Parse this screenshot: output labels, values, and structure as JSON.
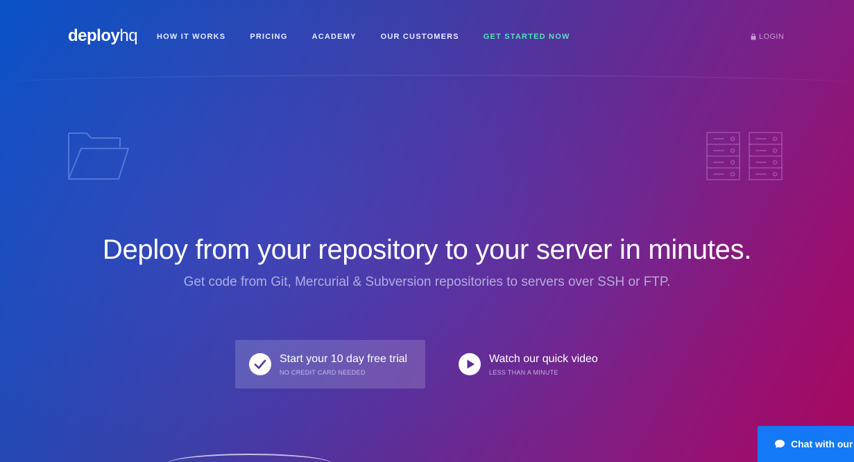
{
  "brand": {
    "logo_bold": "deploy",
    "logo_light": "hq"
  },
  "nav": {
    "items": [
      {
        "label": "HOW IT WORKS"
      },
      {
        "label": "PRICING"
      },
      {
        "label": "ACADEMY"
      },
      {
        "label": "OUR CUSTOMERS"
      },
      {
        "label": "GET STARTED NOW"
      }
    ],
    "login_label": "LOGIN"
  },
  "hero": {
    "headline": "Deploy from your repository to your server in minutes.",
    "subheadline": "Get code from Git, Mercurial & Subversion repositories to servers over SSH or FTP."
  },
  "cta": {
    "trial_title": "Start your 10 day free trial",
    "trial_note": "NO CREDIT CARD NEEDED",
    "video_title": "Watch our quick video",
    "video_note": "LESS THAN A MINUTE"
  },
  "chat": {
    "label": "Chat with our"
  },
  "icons": {
    "login": "lock-icon",
    "trial": "checkmark-icon",
    "video": "play-icon",
    "chat": "chat-bubble-icon",
    "deco_left": "folder-icon",
    "deco_right": "server-rack-icon"
  },
  "colors": {
    "accent_nav": "#52e3b4",
    "chat_button": "#1479f6",
    "gradient_start": "#0a52c8",
    "gradient_end": "#a8085e"
  }
}
